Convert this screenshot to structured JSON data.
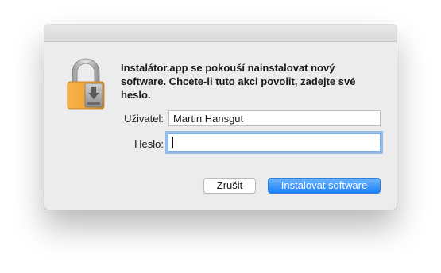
{
  "dialog": {
    "icon": "lock-installer-icon",
    "message": "Instalátor.app se pokouší nainstalovat nový software. Chcete-li tuto akci povolit, zadejte své heslo.",
    "username_label": "Uživatel:",
    "username_value": "Martin Hansgut",
    "password_label": "Heslo:",
    "password_value": "",
    "cancel_label": "Zrušit",
    "install_label": "Instalovat software"
  },
  "colors": {
    "accent": "#1a82fb",
    "dialog_bg": "#ececec",
    "lock_body": "#f2a33a"
  }
}
